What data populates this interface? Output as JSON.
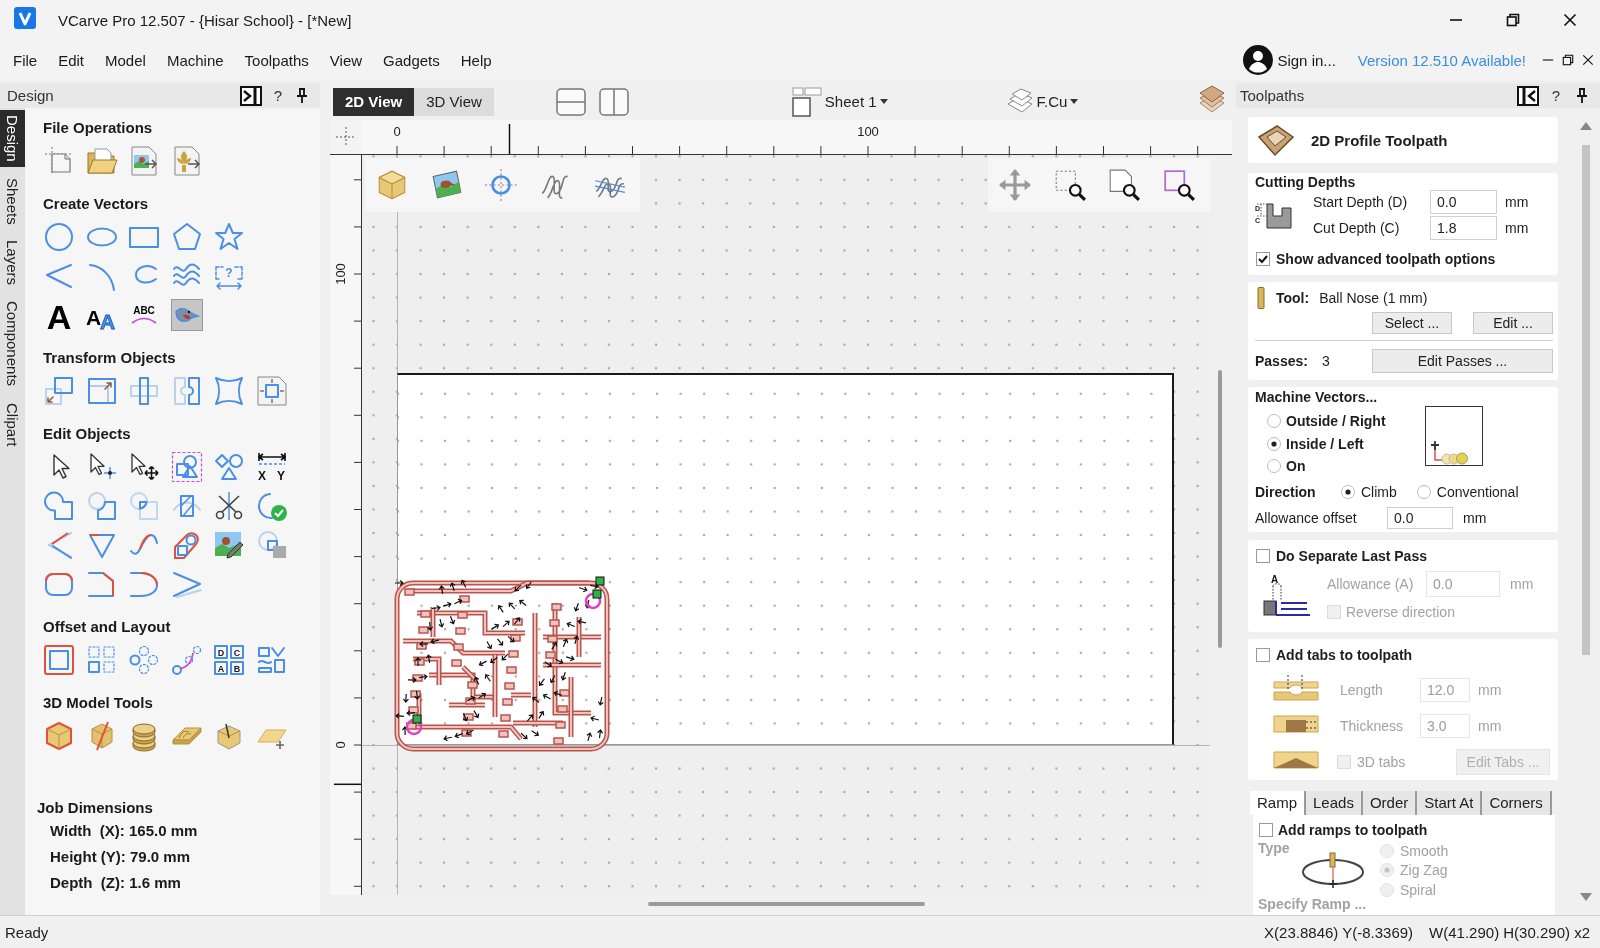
{
  "window": {
    "title": "VCarve Pro 12.507 - {Hisar School} - [*New]"
  },
  "menu": [
    "File",
    "Edit",
    "Model",
    "Machine",
    "Toolpaths",
    "View",
    "Gadgets",
    "Help"
  ],
  "account": {
    "sign_in": "Sign in...",
    "update": "Version 12.510 Available!"
  },
  "design_panel": {
    "title": "Design",
    "help": "?",
    "side_tabs": [
      {
        "label": "Design",
        "selected": true
      },
      {
        "label": "Sheets",
        "selected": false
      },
      {
        "label": "Layers",
        "selected": false
      },
      {
        "label": "Components",
        "selected": false
      },
      {
        "label": "Clipart",
        "selected": false
      }
    ],
    "sections": [
      {
        "title": "File Operations",
        "rows": [
          [
            {
              "kind": "setup",
              "selected": false
            },
            {
              "kind": "open",
              "selected": false
            },
            {
              "kind": "importimage",
              "selected": false
            },
            {
              "kind": "importvector",
              "selected": false
            }
          ]
        ]
      },
      {
        "title": "Create Vectors",
        "rows": [
          [
            {
              "kind": "circle",
              "selected": false
            },
            {
              "kind": "ellipse",
              "selected": false
            },
            {
              "kind": "rectangle",
              "selected": false
            },
            {
              "kind": "polygon",
              "selected": false
            },
            {
              "kind": "star",
              "selected": false
            }
          ],
          [
            {
              "kind": "polyline",
              "selected": false
            },
            {
              "kind": "arc",
              "selected": false
            },
            {
              "kind": "curve",
              "selected": false
            },
            {
              "kind": "wave",
              "selected": false
            },
            {
              "kind": "dimension",
              "selected": false,
              "glyphs": [
                "?"
              ]
            }
          ],
          [
            {
              "kind": "text",
              "selected": false,
              "glyphs": [
                "A"
              ]
            },
            {
              "kind": "outlinetext",
              "selected": false,
              "glyphs": [
                "A",
                "A"
              ]
            },
            {
              "kind": "arctext",
              "selected": false,
              "glyphs": [
                "ABC"
              ]
            },
            {
              "kind": "trace",
              "selected": true
            }
          ]
        ]
      },
      {
        "title": "Transform Objects",
        "rows": [
          [
            {
              "kind": "move",
              "selected": false
            },
            {
              "kind": "scale",
              "selected": false
            },
            {
              "kind": "align",
              "selected": false
            },
            {
              "kind": "mirror",
              "selected": false
            },
            {
              "kind": "distort",
              "selected": false
            },
            {
              "kind": "fit",
              "selected": false
            }
          ]
        ]
      },
      {
        "title": "Edit Objects",
        "rows": [
          [
            {
              "kind": "select",
              "selected": false
            },
            {
              "kind": "node",
              "selected": false
            },
            {
              "kind": "transform",
              "selected": false
            },
            {
              "kind": "group",
              "selected": false
            },
            {
              "kind": "ungroup",
              "selected": false
            },
            {
              "kind": "measure",
              "selected": false,
              "glyphs": [
                "X",
                "Y"
              ]
            }
          ],
          [
            {
              "kind": "weld",
              "selected": false
            },
            {
              "kind": "subtract",
              "selected": false
            },
            {
              "kind": "intersect",
              "selected": false
            },
            {
              "kind": "hatch",
              "selected": false
            },
            {
              "kind": "scissors",
              "selected": false
            },
            {
              "kind": "closecheck",
              "selected": false
            }
          ],
          [
            {
              "kind": "angle",
              "selected": false
            },
            {
              "kind": "triangle",
              "selected": false
            },
            {
              "kind": "sine",
              "selected": false
            },
            {
              "kind": "offsetshape",
              "selected": false
            },
            {
              "kind": "imagepencil",
              "selected": false
            },
            {
              "kind": "imageshape",
              "selected": false
            }
          ],
          [
            {
              "kind": "rounded",
              "selected": false
            },
            {
              "kind": "fillet",
              "selected": false
            },
            {
              "kind": "curvefillet",
              "selected": false
            },
            {
              "kind": "chevron",
              "selected": false
            }
          ]
        ]
      },
      {
        "title": "Offset and Layout",
        "rows": [
          [
            {
              "kind": "offset",
              "selected": false
            },
            {
              "kind": "gridcopy",
              "selected": false
            },
            {
              "kind": "circlecopy",
              "selected": false
            },
            {
              "kind": "pathcopy",
              "selected": false
            },
            {
              "kind": "steprepeat",
              "selected": false,
              "glyphs": [
                "D",
                "C",
                "A",
                "B"
              ]
            },
            {
              "kind": "nesting",
              "selected": false
            }
          ]
        ]
      },
      {
        "title": "3D Model Tools",
        "rows": [
          [
            {
              "kind": "cube",
              "selected": false
            },
            {
              "kind": "slicedcube",
              "selected": false
            },
            {
              "kind": "discs",
              "selected": false
            },
            {
              "kind": "contour",
              "selected": false
            },
            {
              "kind": "probecube",
              "selected": false
            },
            {
              "kind": "slabplus",
              "selected": false
            }
          ]
        ]
      }
    ],
    "job_dimensions": {
      "title": "Job Dimensions",
      "rows": [
        "Width  (X): 165.0 mm",
        "Height (Y): 79.0 mm",
        "Depth  (Z): 1.6 mm"
      ]
    }
  },
  "view": {
    "view_tabs": [
      {
        "label": "2D View",
        "selected": true
      },
      {
        "label": "3D View",
        "selected": false
      }
    ],
    "sheet": "Sheet 1",
    "layer": "F.Cu",
    "rulers": {
      "horizontal": [
        "0",
        "100"
      ],
      "vertical": [
        "100",
        "0"
      ]
    }
  },
  "toolpaths_panel": {
    "title": "Toolpaths",
    "help": "?",
    "heading": "2D Profile Toolpath",
    "cutting_depths": {
      "title": "Cutting Depths",
      "diagram_labels": [
        "D",
        "C"
      ],
      "fields": [
        {
          "label": "Start Depth (D)",
          "value": "0.0",
          "unit": "mm"
        },
        {
          "label": "Cut Depth (C)",
          "value": "1.8",
          "unit": "mm"
        }
      ],
      "advanced": {
        "label": "Show advanced toolpath options",
        "checked": true
      }
    },
    "tool": {
      "label": "Tool:",
      "name": "Ball Nose (1 mm)",
      "buttons": [
        "Select ...",
        "Edit ..."
      ]
    },
    "passes": {
      "label": "Passes:",
      "value": "3",
      "button": "Edit Passes ..."
    },
    "machine_vectors": {
      "title": "Machine Vectors...",
      "sides": [
        {
          "label": "Outside / Right",
          "selected": false
        },
        {
          "label": "Inside / Left",
          "selected": true
        },
        {
          "label": "On",
          "selected": false
        }
      ],
      "direction": {
        "label": "Direction",
        "options": [
          {
            "label": "Climb",
            "selected": true
          },
          {
            "label": "Conventional",
            "selected": false
          }
        ]
      },
      "allowance": {
        "label": "Allowance offset",
        "value": "0.0",
        "unit": "mm"
      }
    },
    "last_pass": {
      "label": "Do Separate Last Pass",
      "checked": false,
      "disabled": true,
      "diagram_label": "A",
      "allowance": {
        "label": "Allowance (A)",
        "value": "0.0",
        "unit": "mm"
      },
      "reverse": {
        "label": "Reverse direction",
        "checked": false
      }
    },
    "tabs": {
      "label": "Add tabs to toolpath",
      "checked": false,
      "disabled": true,
      "fields": [
        {
          "label": "Length",
          "value": "12.0",
          "unit": "mm"
        },
        {
          "label": "Thickness",
          "value": "3.0",
          "unit": "mm"
        }
      ],
      "three_d": {
        "label": "3D tabs",
        "checked": false
      },
      "button": "Edit Tabs ..."
    },
    "option_tabs": [
      {
        "label": "Ramp",
        "selected": true
      },
      {
        "label": "Leads",
        "selected": false
      },
      {
        "label": "Order",
        "selected": false
      },
      {
        "label": "Start At",
        "selected": false
      },
      {
        "label": "Corners",
        "selected": false
      }
    ],
    "ramp": {
      "label": "Add ramps to toolpath",
      "checked": false,
      "disabled": true,
      "type_label": "Type",
      "types": [
        {
          "label": "Smooth",
          "selected": false
        },
        {
          "label": "Zig Zag",
          "selected": true
        },
        {
          "label": "Spiral",
          "selected": false
        }
      ],
      "more": "Specify Ramp ..."
    }
  },
  "status_bar": {
    "message": "Ready",
    "cursor": "X(23.8846) Y(-8.3369)",
    "selection": "W(41.290) H(30.290) x2"
  }
}
